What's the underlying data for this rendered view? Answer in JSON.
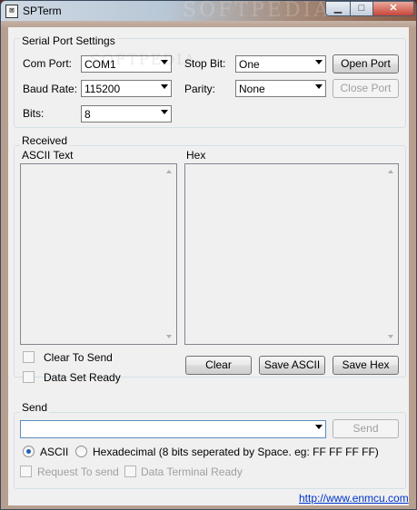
{
  "window": {
    "title": "SPTerm",
    "watermark": "SOFTPEDIA",
    "app_icon_glyph": "⊠"
  },
  "serial_settings": {
    "group_label": "Serial Port Settings",
    "com_port": {
      "label": "Com Port:",
      "value": "COM1"
    },
    "baud_rate": {
      "label": "Baud Rate:",
      "value": "115200"
    },
    "bits": {
      "label": "Bits:",
      "value": "8"
    },
    "stop_bit": {
      "label": "Stop Bit:",
      "value": "One"
    },
    "parity": {
      "label": "Parity:",
      "value": "None"
    },
    "open_port_label": "Open Port",
    "close_port_label": "Close Port"
  },
  "received": {
    "group_label": "Received",
    "ascii_label": "ASCII Text",
    "hex_label": "Hex",
    "clear_to_send_label": "Clear To Send",
    "data_set_ready_label": "Data Set Ready",
    "clear_label": "Clear",
    "save_ascii_label": "Save ASCII",
    "save_hex_label": "Save Hex"
  },
  "send": {
    "group_label": "Send",
    "input_value": "",
    "send_label": "Send",
    "ascii_radio_label": "ASCII",
    "hex_radio_label": "Hexadecimal (8 bits seperated by Space. eg: FF FF FF FF)",
    "selected_mode": "ASCII",
    "request_to_send_label": "Request To send",
    "data_terminal_ready_label": "Data Terminal Ready"
  },
  "footer": {
    "link_text": "http://www.enmcu.com"
  },
  "colors": {
    "link": "#0033cc",
    "radio_selected": "#1e5fb4",
    "disabled_text": "#a0a0a0"
  }
}
